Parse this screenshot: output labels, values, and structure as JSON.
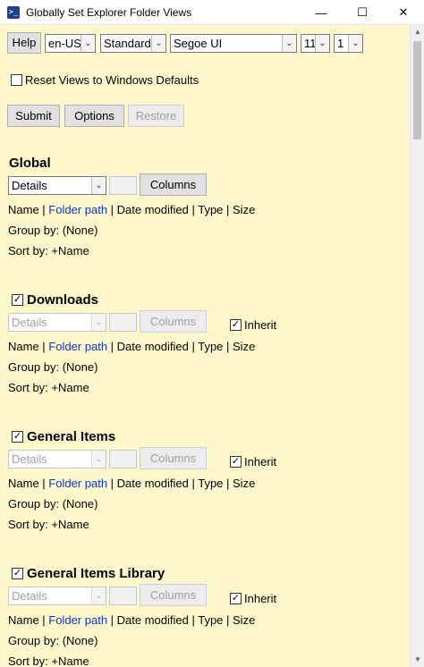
{
  "window": {
    "title": "Globally Set Explorer Folder Views",
    "app_icon_glyph": ">_",
    "minimize_glyph": "—",
    "maximize_glyph": "☐",
    "close_glyph": "✕",
    "background": "#fff8cc"
  },
  "toolbar": {
    "help_label": "Help",
    "language_value": "en-US",
    "style_value": "Standard",
    "font_value": "Segoe UI",
    "size_value": "11",
    "scale_value": "1",
    "dropdown_glyph": "⌄"
  },
  "reset": {
    "label": "Reset Views to Windows Defaults",
    "checked": false
  },
  "actions": {
    "submit_label": "Submit",
    "options_label": "Options",
    "restore_label": "Restore"
  },
  "sections": [
    {
      "title": "Global",
      "checked": null,
      "view_value": "Details",
      "columns_label": "Columns",
      "inherit_label": "",
      "columns_parts": [
        "Name | ",
        "Folder path",
        " | Date modified | Type | Size"
      ],
      "group_by": "Group by: (None)",
      "sort_by": "Sort by: +Name"
    },
    {
      "title": "Downloads",
      "checked": true,
      "view_value": "Details",
      "columns_label": "Columns",
      "inherit_label": "Inherit",
      "columns_parts": [
        "Name | ",
        "Folder path",
        " | Date modified | Type | Size"
      ],
      "group_by": "Group by: (None)",
      "sort_by": "Sort by: +Name"
    },
    {
      "title": "General Items",
      "checked": true,
      "view_value": "Details",
      "columns_label": "Columns",
      "inherit_label": "Inherit",
      "columns_parts": [
        "Name | ",
        "Folder path",
        " | Date modified | Type | Size"
      ],
      "group_by": "Group by: (None)",
      "sort_by": "Sort by: +Name"
    },
    {
      "title": "General Items Library",
      "checked": true,
      "view_value": "Details",
      "columns_label": "Columns",
      "inherit_label": "Inherit",
      "columns_parts": [
        "Name | ",
        "Folder path",
        " | Date modified | Type | Size"
      ],
      "group_by": "Group by: (None)",
      "sort_by": "Sort by: +Name"
    }
  ],
  "scrollbar": {
    "up_glyph": "▲",
    "down_glyph": "▼"
  },
  "colors": {
    "link": "#0b36c8",
    "disabled_text": "#a0a0a0"
  }
}
